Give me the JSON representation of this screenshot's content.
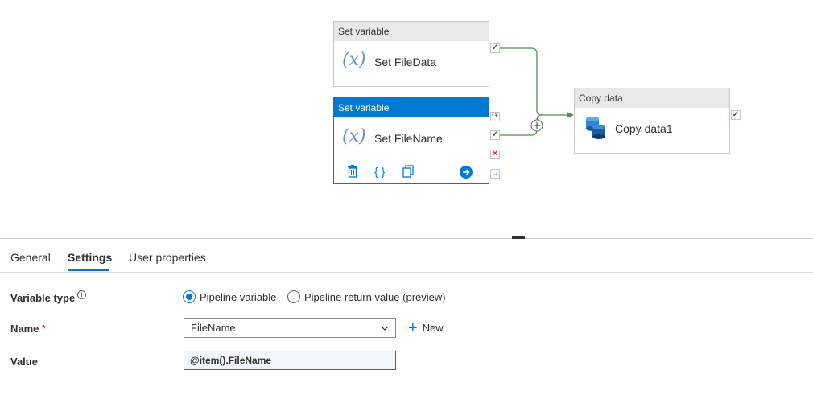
{
  "activities": [
    {
      "header": "Set variable",
      "name": "Set FileData",
      "icon": "fx-icon"
    },
    {
      "header": "Set variable",
      "name": "Set FileName",
      "icon": "fx-icon",
      "selected": true
    },
    {
      "header": "Copy data",
      "name": "Copy data1",
      "icon": "database-icon"
    }
  ],
  "tabs": [
    {
      "label": "General"
    },
    {
      "label": "Settings",
      "active": true
    },
    {
      "label": "User properties"
    }
  ],
  "form": {
    "variable_type_label": "Variable type",
    "radio_pipeline_variable": "Pipeline variable",
    "radio_pipeline_return": "Pipeline return value (preview)",
    "selected_radio": "Pipeline variable",
    "name_label": "Name",
    "required_mark": "*",
    "name_value": "FileName",
    "new_label": "New",
    "value_label": "Value",
    "value_value": "@item().FileName"
  },
  "colors": {
    "accent": "#0078d4",
    "success": "#107c10",
    "fail": "#d13438",
    "edge": "#4f8f4f"
  }
}
